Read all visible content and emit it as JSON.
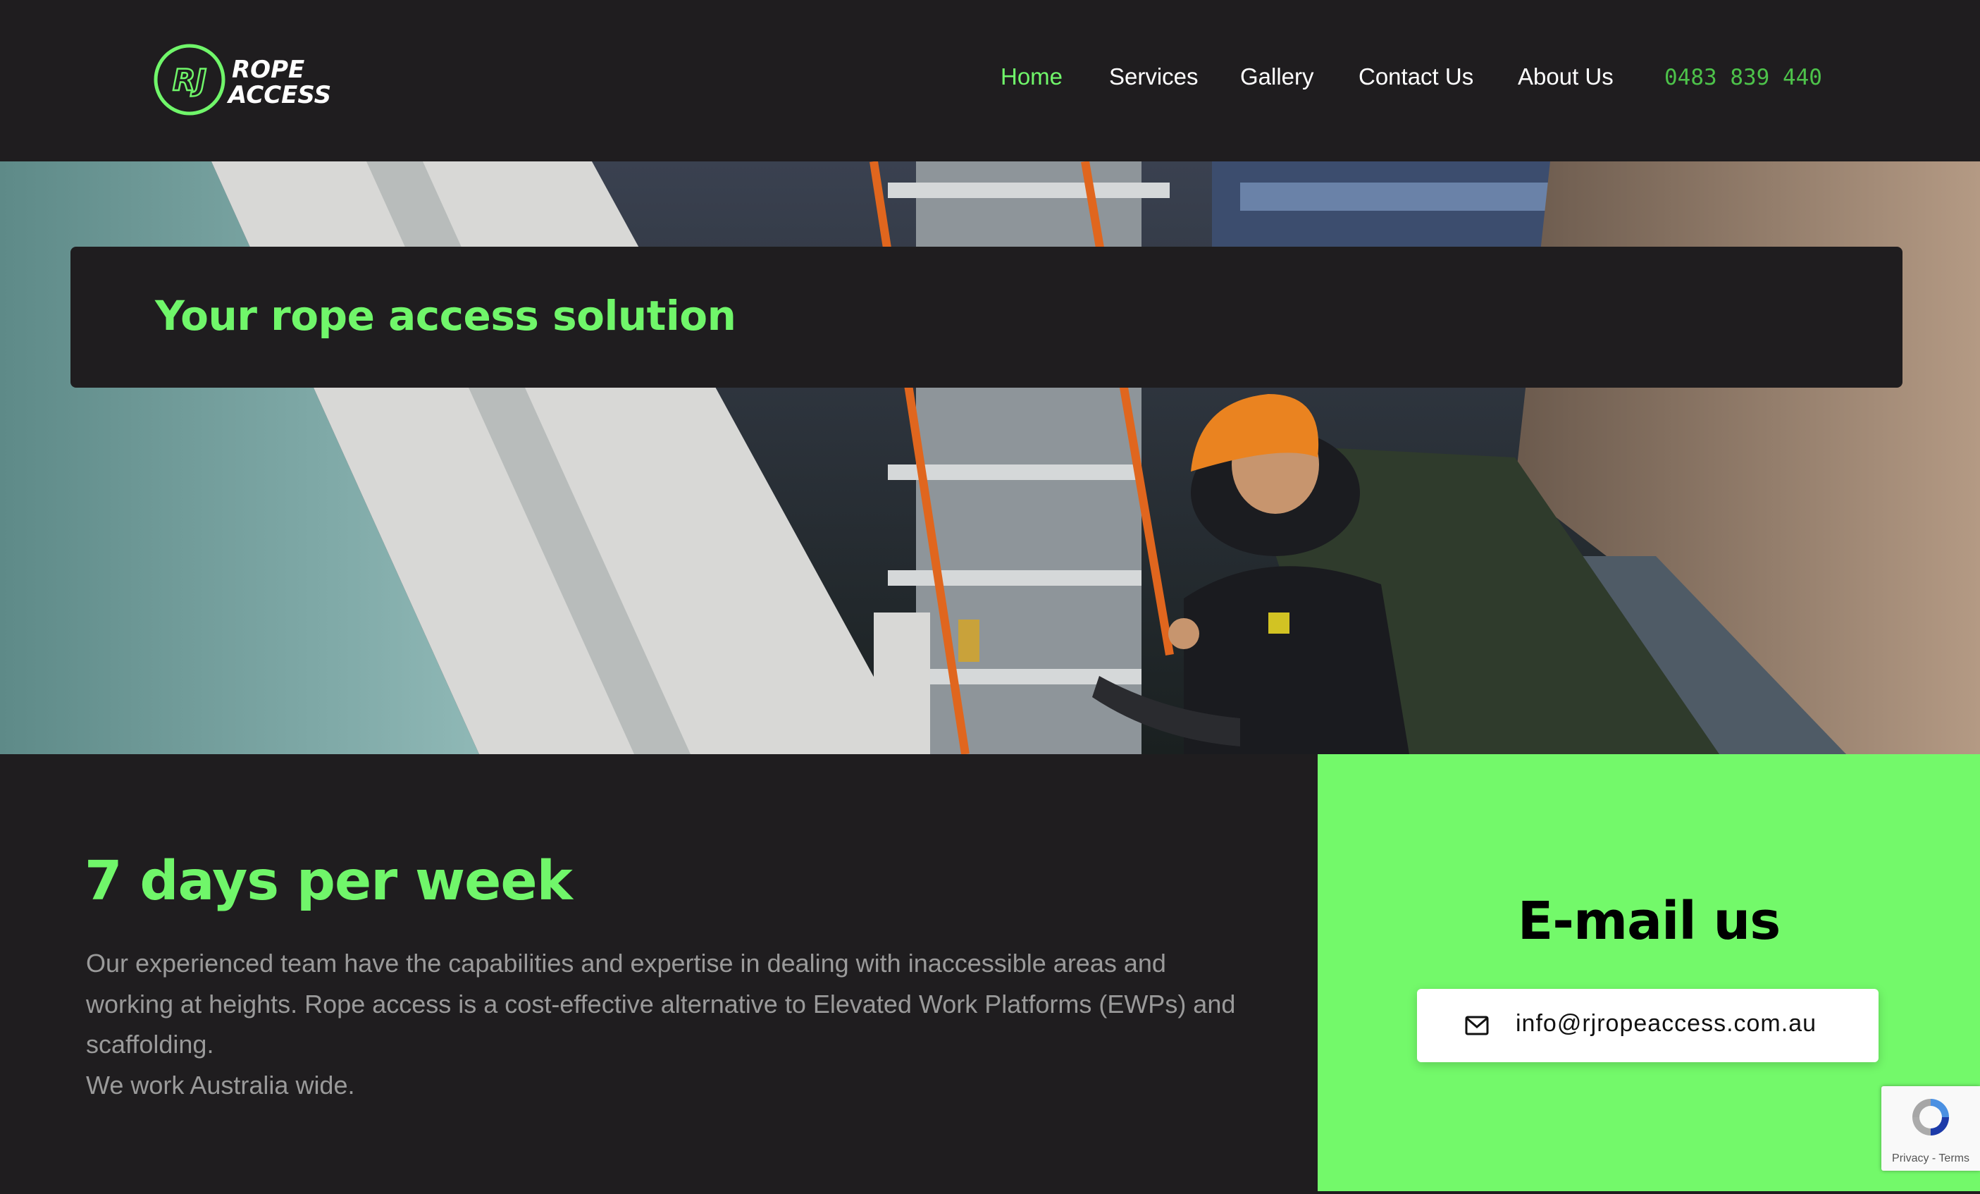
{
  "header": {
    "logo_mark": "RJ",
    "logo_line1": "ROPE",
    "logo_line2": "ACCESS",
    "nav": [
      {
        "label": "Home",
        "active": true
      },
      {
        "label": "Services",
        "active": false
      },
      {
        "label": "Gallery",
        "active": false
      },
      {
        "label": "Contact Us",
        "active": false
      },
      {
        "label": "About Us",
        "active": false
      }
    ],
    "phone": "0483 839 440"
  },
  "hero": {
    "title": "Your rope access solution",
    "image": "rope-access-worker-on-building-photo"
  },
  "info": {
    "heading": "7 days per week",
    "paragraph1": "Our experienced team have the capabilities and expertise in dealing with inaccessible areas and working at heights. Rope access is a cost-effective alternative to Elevated Work Platforms (EWPs) and scaffolding.",
    "paragraph2": "We work Australia wide."
  },
  "email_panel": {
    "heading": "E-mail us",
    "email": "info@rjropeaccess.com.au",
    "icon": "envelope-icon"
  },
  "recaptcha": {
    "links": "Privacy - Terms",
    "icon": "recaptcha-icon"
  },
  "colors": {
    "background": "#1f1d1f",
    "accent": "#70f66a",
    "phone": "#4dc24a",
    "panel": "#73f96a"
  }
}
